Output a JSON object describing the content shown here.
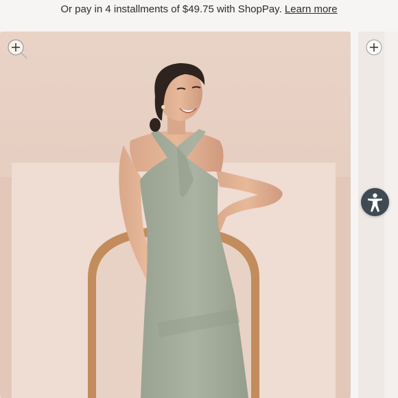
{
  "installments": {
    "text": "Or pay in 4 installments of $49.75 with ShopPay.",
    "link_label": "Learn more"
  },
  "gallery": {
    "main_image": {
      "subject": "model-in-sage-halter-gown",
      "dress_color": "#a4ab9b",
      "backdrop_color": "#ebd6cc",
      "arch_color": "#c4905f"
    },
    "zoom_icon": "zoom-in-icon",
    "next_zoom_icon": "plus-icon"
  },
  "accessibility": {
    "icon": "accessibility-icon",
    "color": "#3f4a52"
  }
}
